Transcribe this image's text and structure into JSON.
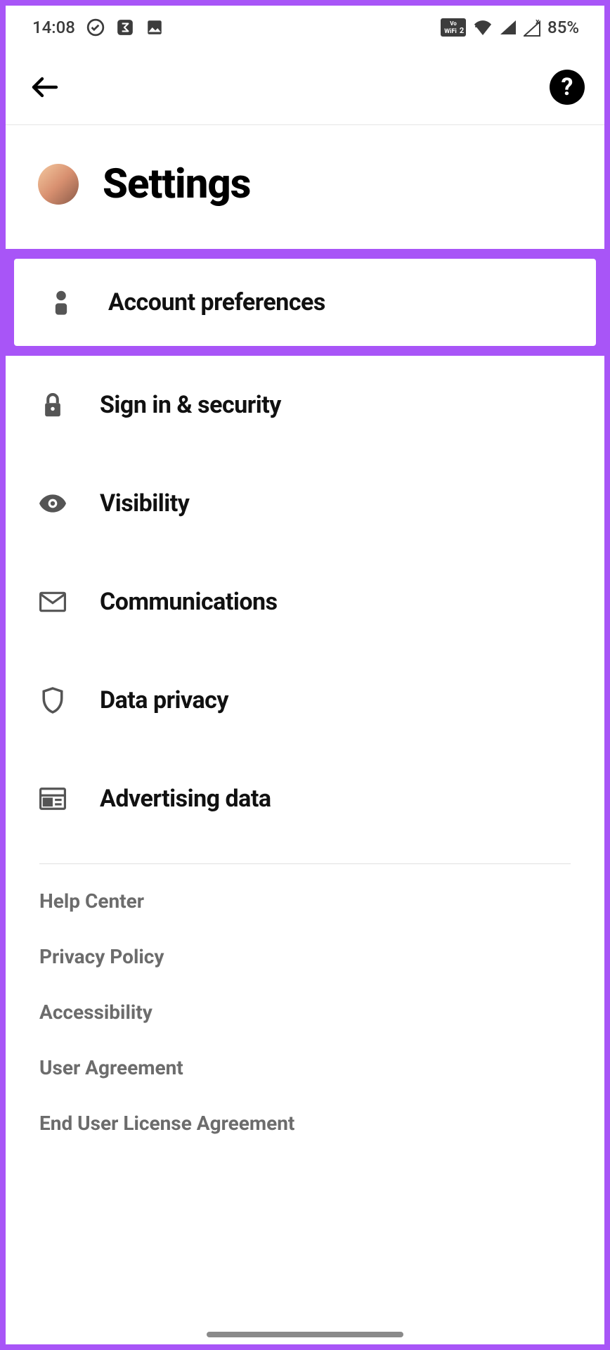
{
  "status_bar": {
    "time": "14:08",
    "battery": "85%"
  },
  "header": {
    "title": "Settings"
  },
  "items": [
    {
      "label": "Account preferences"
    },
    {
      "label": "Sign in & security"
    },
    {
      "label": "Visibility"
    },
    {
      "label": "Communications"
    },
    {
      "label": "Data privacy"
    },
    {
      "label": "Advertising data"
    }
  ],
  "footer_links": [
    "Help Center",
    "Privacy Policy",
    "Accessibility",
    "User Agreement",
    "End User License Agreement"
  ]
}
